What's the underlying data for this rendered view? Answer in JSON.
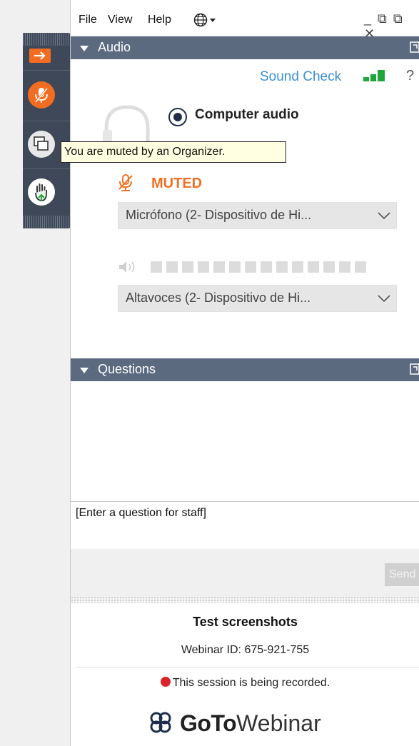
{
  "menu": {
    "file": "File",
    "view": "View",
    "help": "Help"
  },
  "window_controls": "_ ⧉ ⧉ ✕",
  "audio": {
    "header": "Audio",
    "sound_check": "Sound Check",
    "help": "?",
    "computer_audio": "Computer audio",
    "muted_label": "MUTED",
    "microphone_select": "Micrófono (2- Dispositivo de Hi...",
    "speaker_select": "Altavoces (2- Dispositivo de Hi..."
  },
  "tooltip": "You are muted by an Organizer.",
  "questions": {
    "header": "Questions",
    "input_placeholder": "[Enter a question for staff]",
    "send": "Send"
  },
  "footer": {
    "webinar_title": "Test screenshots",
    "webinar_id": "Webinar ID: 675-921-755",
    "recording": "This session is being recorded.",
    "brand_bold": "GoTo",
    "brand_regular": "Webinar"
  },
  "colors": {
    "header_bg": "#5c6a80",
    "accent_orange": "#f27025",
    "link_blue": "#3a8fd6",
    "signal_green": "#1fa63a",
    "record_red": "#d9252a"
  }
}
